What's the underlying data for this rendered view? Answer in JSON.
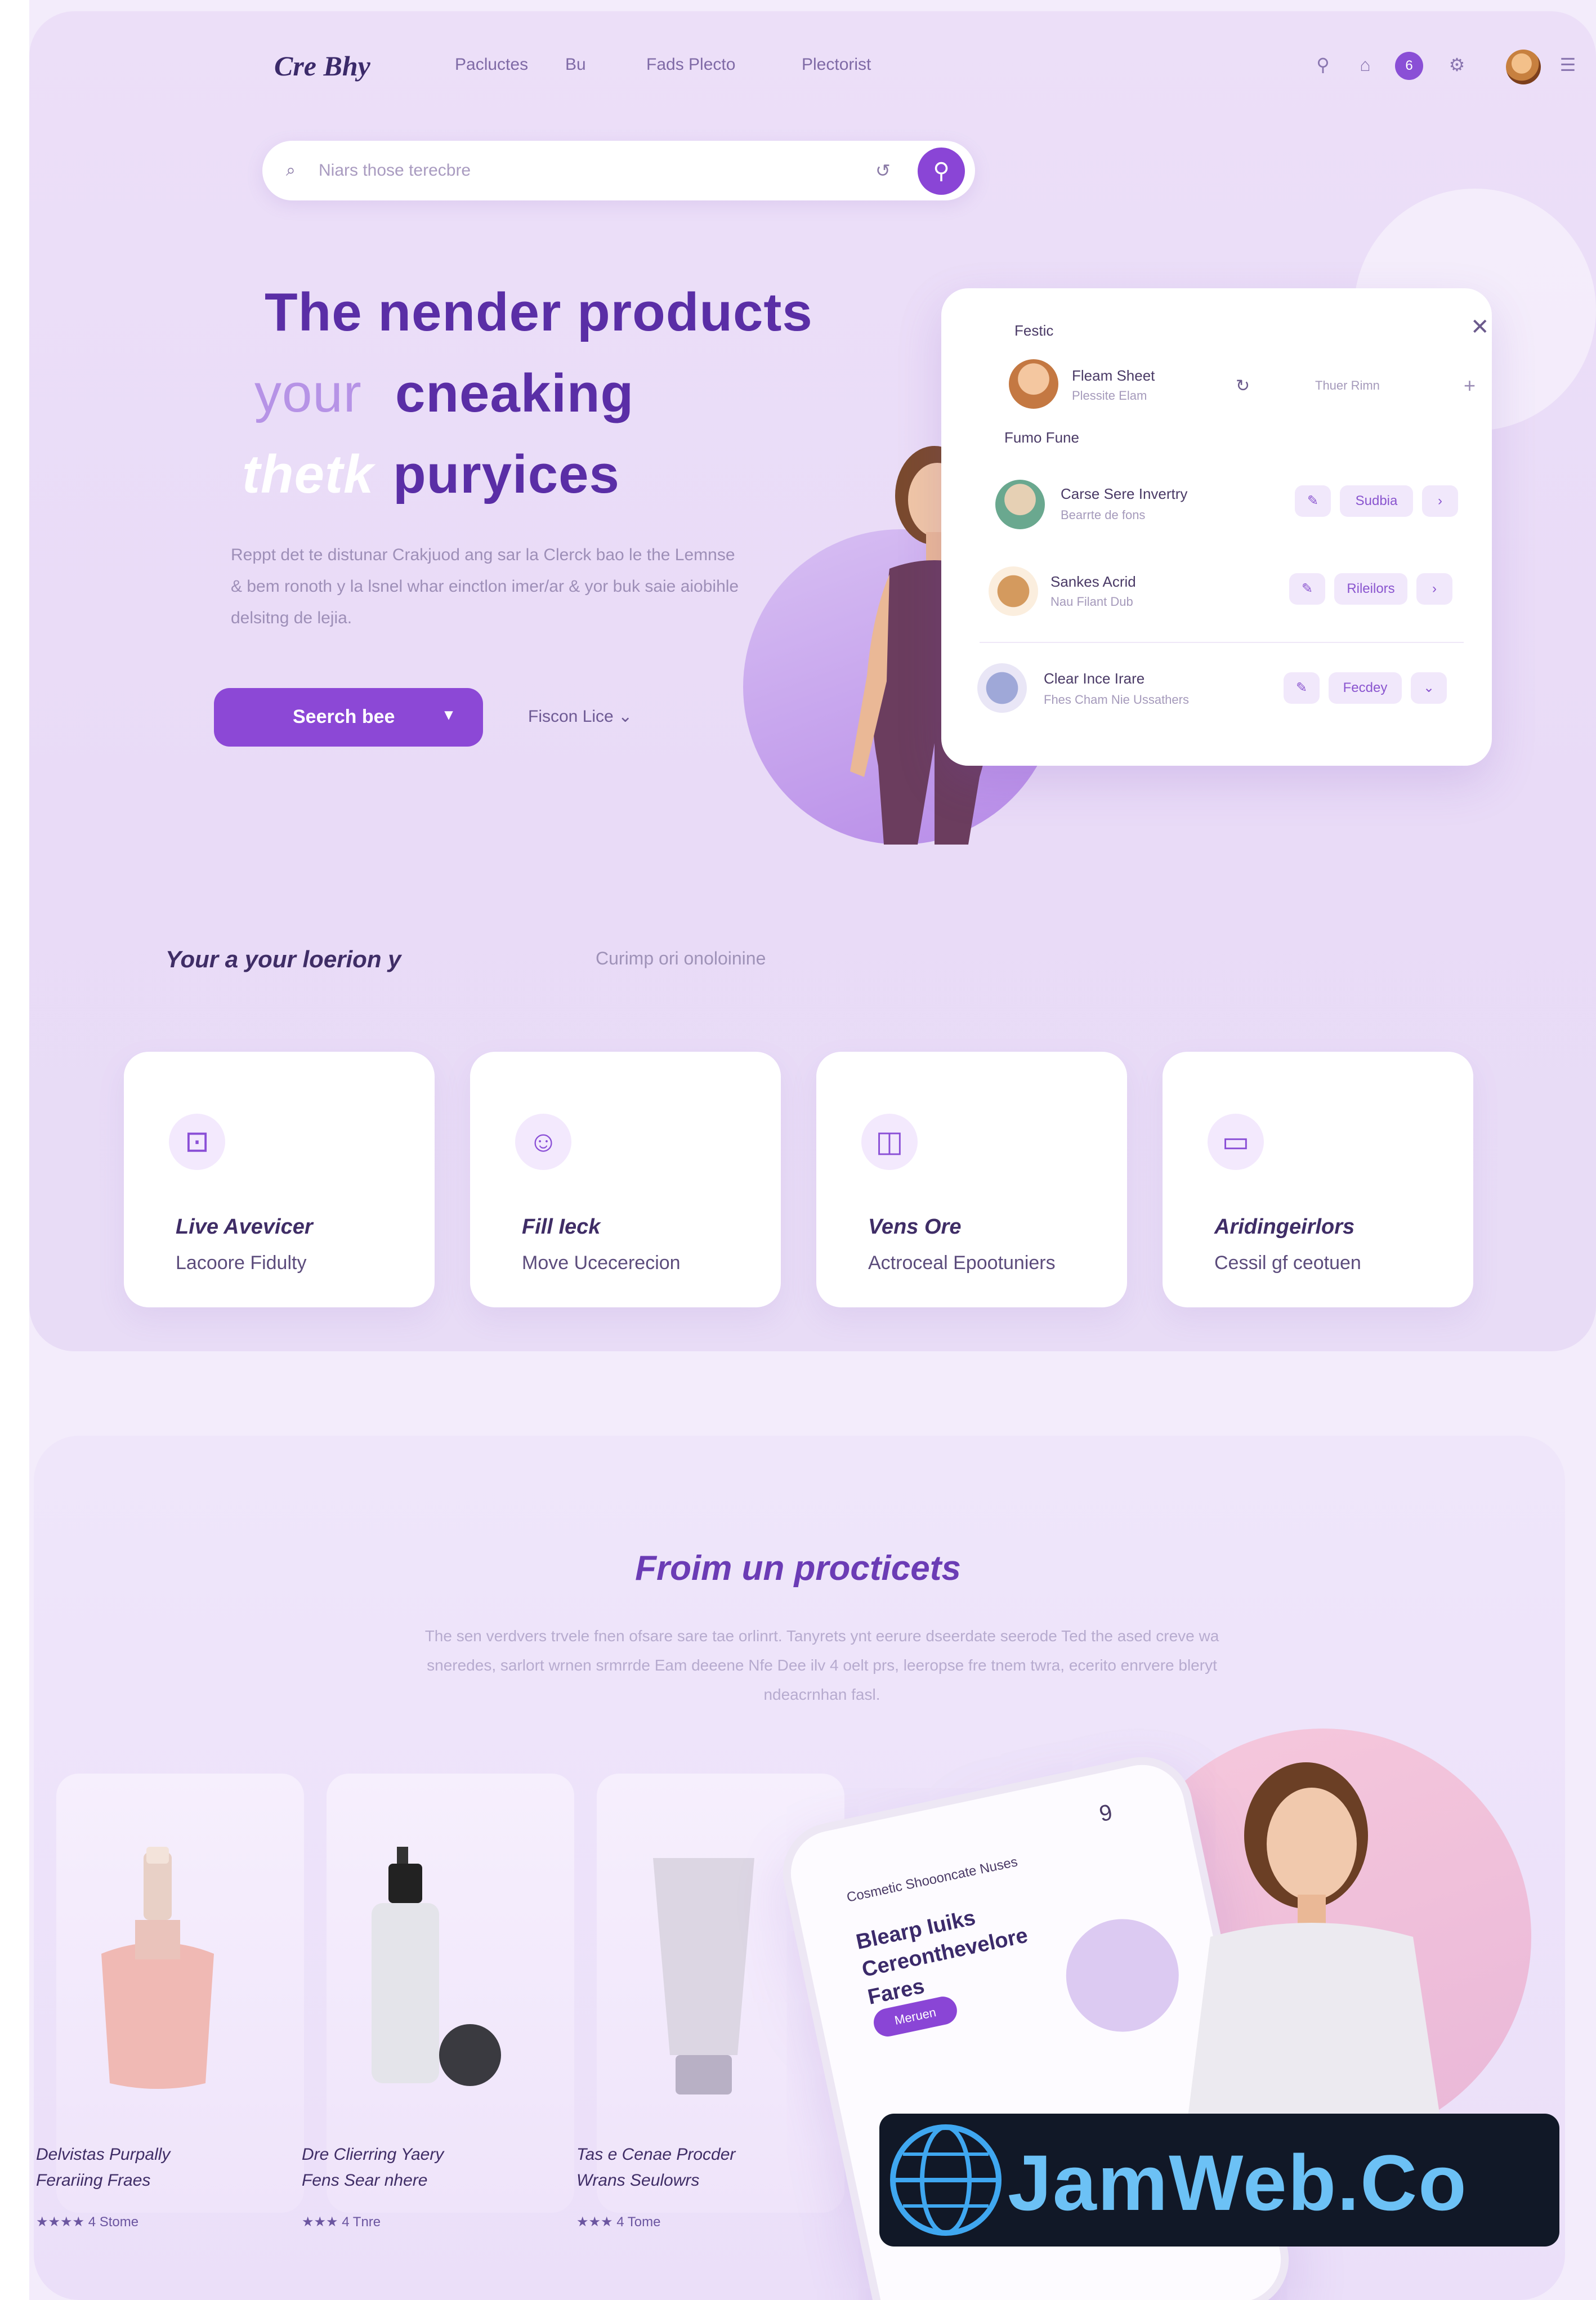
{
  "nav": {
    "logo": "Cre Bhy",
    "links": [
      "Pacluctes",
      "Bu",
      "Fads Plecto",
      "Plectorist"
    ],
    "badge": "6"
  },
  "search": {
    "label": "Search",
    "placeholder": "Niars those terecbre"
  },
  "hero": {
    "line1": "The nender products",
    "line2_a": "your",
    "line2_b": "cneaking",
    "line3_a": "thetk",
    "line3_b": "puryices",
    "body": "Reppt det te distunar Crakjuod ang sar la Clerck bao le the Lemnse & bem ronoth y la lsnel whar einctlon imer/ar & yor buk saie aiobihle delsitng de lejia.",
    "cta": "Seerch bee",
    "secondary": "Fiscon Lice"
  },
  "product_card": {
    "header": "Festic",
    "top_item": {
      "name": "Fleam Sheet",
      "sub": "Plessite Elam",
      "meta": "Thuer Rimn"
    },
    "subheader": "Fumo Fune",
    "items": [
      {
        "name": "Carse Sere Invertry",
        "sub": "Bearrte de fons",
        "chip": "Sudbia"
      },
      {
        "name": "Sankes Acrid",
        "sub": "Nau Filant Dub",
        "chip": "Rileilors"
      },
      {
        "name": "Clear Ince Irare",
        "sub": "Fhes Cham Nie Ussathers",
        "chip": "Fecdey"
      }
    ]
  },
  "categories_section": {
    "title": "Your a your loerion y",
    "subtitle": "Curimp ori onoloinine",
    "cards": [
      {
        "title": "Live Avevicer",
        "sub": "Lacoore Fidulty",
        "icon": "gift-icon"
      },
      {
        "title": "Fill Ieck",
        "sub": "Move Ucecerecion",
        "icon": "face-icon"
      },
      {
        "title": "Vens Ore",
        "sub": "Actroceal Epootuniers",
        "icon": "shopping-bag-icon"
      },
      {
        "title": "Aridingeirlors",
        "sub": "Cessil gf ceotuen",
        "icon": "card-icon"
      }
    ]
  },
  "practices_section": {
    "title": "Froim un procticets",
    "body": "The sen verdvers trvele fnen ofsare sare tae orlinrt. Tanyrets ynt eerure dseerdate seerode Ted the ased creve wa sneredes, sarlort wrnen srmrrde Eam deeene Nfe Dee ilv 4 oelt prs, leeropse fre tnem twra, ecerito enrvere bleryt ndeacrnhan fasl."
  },
  "products": [
    {
      "name": "Delvistas Purpally",
      "name2": "Ferariing Fraes",
      "rating": "★★★★ 4 Stome"
    },
    {
      "name": "Dre Clierring Yaery",
      "name2": "Fens Sear nhere",
      "rating": "★★★ 4 Tnre"
    },
    {
      "name": "Tas e Cenae Procder",
      "name2": "Wrans Seulowrs",
      "rating": "★★★ 4 Tome"
    }
  ],
  "phone_screen": {
    "header": "Cosmetic Shoooncate Nuses",
    "headline": "Blearp Iuiks Cereonthevelore Fares",
    "pill": "Meruen",
    "num": "9"
  },
  "watermark": {
    "text": "JamWeb.Co"
  },
  "colors": {
    "accent": "#8a45d6",
    "background": "#f3ecfb",
    "hero_dark": "#5a2ea6",
    "hero_light": "#b693e6"
  }
}
